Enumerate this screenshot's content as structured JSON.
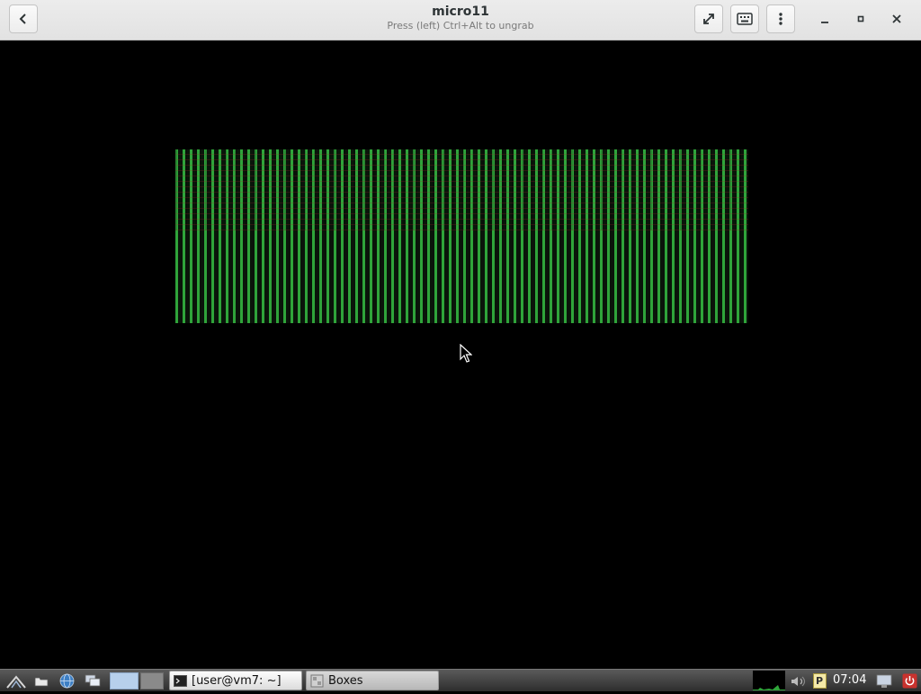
{
  "window": {
    "title": "micro11",
    "subtitle": "Press (left) Ctrl+Alt to ungrab"
  },
  "taskbar": {
    "tasks": [
      {
        "label": "[user@vm7: ~]",
        "icon": "terminal-icon"
      },
      {
        "label": "Boxes",
        "icon": "boxes-icon"
      }
    ],
    "clock": "07:04",
    "tray_p_label": "P"
  },
  "colors": {
    "glitch_green": "#2fa43a",
    "headerbar": "#e6e6e6",
    "taskbar": "#3a3a3a"
  }
}
